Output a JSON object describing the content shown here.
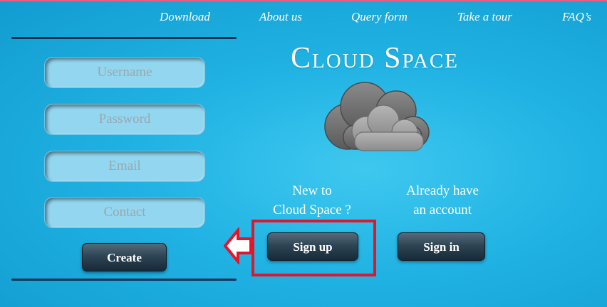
{
  "nav": {
    "items": [
      "Download",
      "About us",
      "Query form",
      "Take a tour",
      "FAQ’s"
    ]
  },
  "form": {
    "username_placeholder": "Username",
    "password_placeholder": "Password",
    "email_placeholder": "Email",
    "contact_placeholder": "Contact",
    "create_label": "Create"
  },
  "brand": {
    "title": "Cloud Space",
    "logo_icon": "cloud-icon"
  },
  "signup": {
    "caption_line1": "New to",
    "caption_line2": "Cloud Space ?",
    "button_label": "Sign up"
  },
  "signin": {
    "caption_line1": "Already have",
    "caption_line2": "an account",
    "button_label": "Sign in"
  },
  "annotation": {
    "arrow_icon": "left-arrow-icon",
    "highlight_color": "#e3152b"
  },
  "colors": {
    "background": "#20b2e3",
    "button": "#2f4555",
    "field": "#93d6ef",
    "rule": "#0d2f52"
  }
}
